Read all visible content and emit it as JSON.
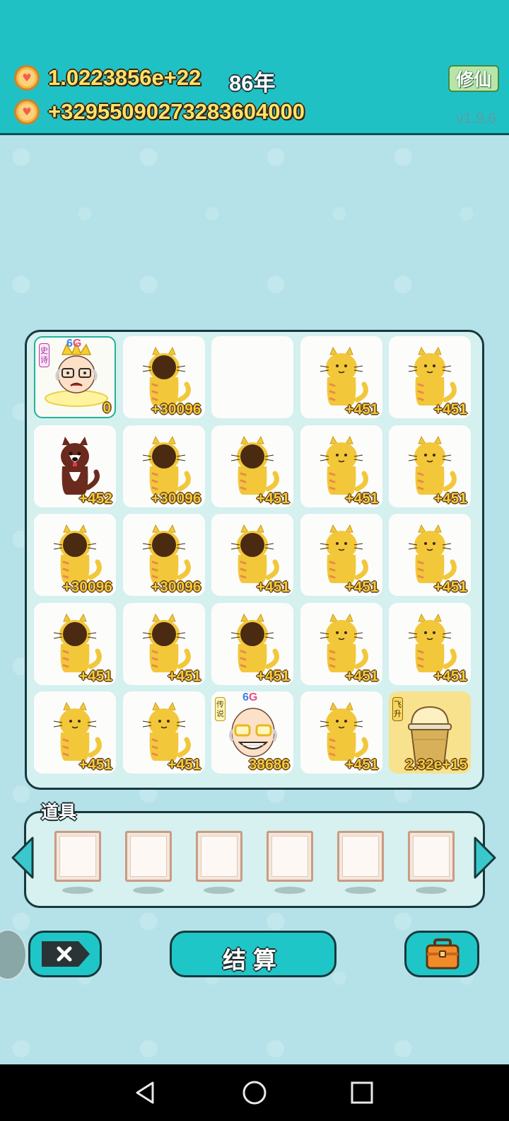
{
  "header": {
    "coins_total": "1.0223856e+22",
    "year": "86年",
    "coins_rate": "+3295509027328360",
    "coins_rate_tail": "4000",
    "xiuxian_label": "修仙",
    "version": "v1.9.6"
  },
  "board": {
    "cells": [
      {
        "kind": "old-man-king",
        "value": "0",
        "tag": "史诗",
        "badge": "6G"
      },
      {
        "kind": "cat-dark",
        "value": "+30096"
      },
      {
        "kind": "empty",
        "value": ""
      },
      {
        "kind": "cat",
        "value": "+451"
      },
      {
        "kind": "cat",
        "value": "+451"
      },
      {
        "kind": "dog",
        "value": "+452"
      },
      {
        "kind": "cat-dark",
        "value": "+30096"
      },
      {
        "kind": "cat-dark",
        "value": "+451"
      },
      {
        "kind": "cat",
        "value": "+451"
      },
      {
        "kind": "cat",
        "value": "+451"
      },
      {
        "kind": "cat-dark",
        "value": "+30096"
      },
      {
        "kind": "cat-dark",
        "value": "+30096"
      },
      {
        "kind": "cat-dark",
        "value": "+451"
      },
      {
        "kind": "cat",
        "value": "+451"
      },
      {
        "kind": "cat",
        "value": "+451"
      },
      {
        "kind": "cat-dark",
        "value": "+451"
      },
      {
        "kind": "cat-dark",
        "value": "+451"
      },
      {
        "kind": "cat-dark",
        "value": "+451"
      },
      {
        "kind": "cat",
        "value": "+451"
      },
      {
        "kind": "cat",
        "value": "+451"
      },
      {
        "kind": "cat",
        "value": "+451"
      },
      {
        "kind": "cat",
        "value": "+451"
      },
      {
        "kind": "old-man-glasses",
        "value": "38686",
        "tag": "传说",
        "badge": "6G"
      },
      {
        "kind": "cat",
        "value": "+451"
      },
      {
        "kind": "cup",
        "value": "2.32e+15",
        "tag": "飞升"
      }
    ]
  },
  "items": {
    "title": "道具",
    "slots": 6
  },
  "buttons": {
    "settle_label": "结算"
  },
  "colors": {
    "topbar": "#20c1c4",
    "background": "#b6e3e9",
    "value_text": "#f6c93a"
  }
}
